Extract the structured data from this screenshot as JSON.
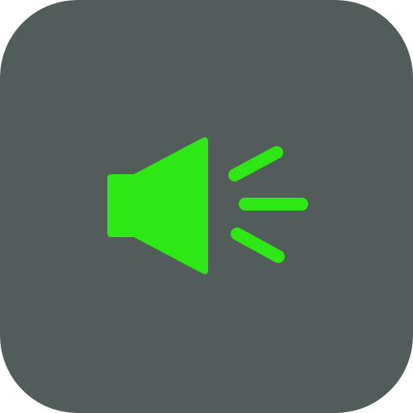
{
  "icon": {
    "name": "speaker-volume-icon",
    "background_color": "#525c5a",
    "glyph_color": "#2ee816"
  }
}
